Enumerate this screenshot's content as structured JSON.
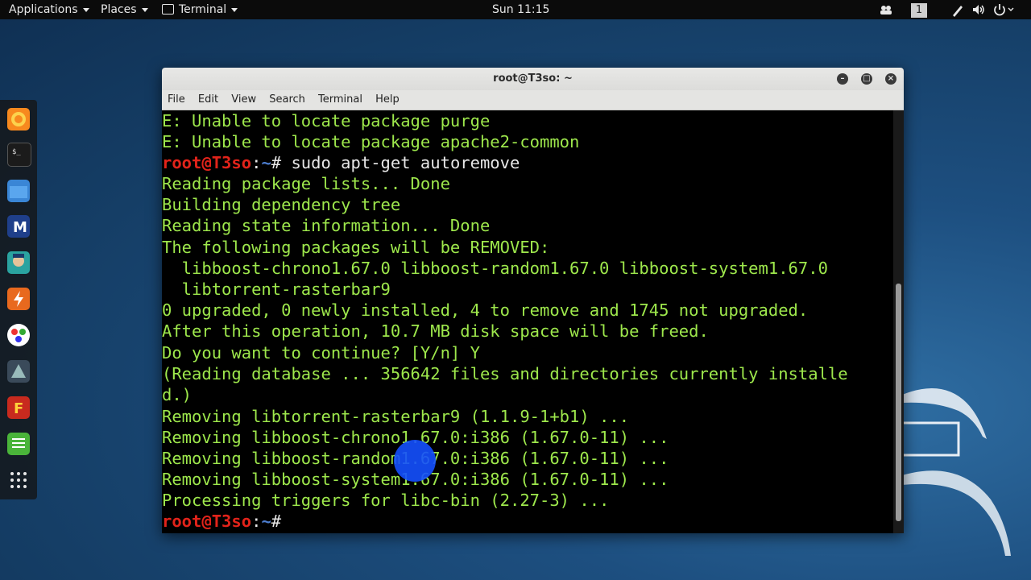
{
  "topbar": {
    "applications": "Applications",
    "places": "Places",
    "terminal": "Terminal",
    "clock": "Sun 11:15",
    "workspace": "1"
  },
  "window": {
    "title": "root@T3so: ~",
    "menu": [
      "File",
      "Edit",
      "View",
      "Search",
      "Terminal",
      "Help"
    ]
  },
  "prompt": {
    "user": "root@T3so",
    "sep": ":",
    "dir": "~",
    "hash": "#"
  },
  "command": " sudo apt-get autoremove",
  "output_before": [
    "E: Unable to locate package purge",
    "E: Unable to locate package apache2-common"
  ],
  "output_after": [
    "Reading package lists... Done",
    "Building dependency tree",
    "Reading state information... Done",
    "The following packages will be REMOVED:",
    "  libboost-chrono1.67.0 libboost-random1.67.0 libboost-system1.67.0",
    "  libtorrent-rasterbar9",
    "0 upgraded, 0 newly installed, 4 to remove and 1745 not upgraded.",
    "After this operation, 10.7 MB disk space will be freed.",
    "Do you want to continue? [Y/n] Y",
    "(Reading database ... 356642 files and directories currently installe",
    "d.)",
    "Removing libtorrent-rasterbar9 (1.1.9-1+b1) ...",
    "Removing libboost-chrono1.67.0:i386 (1.67.0-11) ...",
    "Removing libboost-random1.67.0:i386 (1.67.0-11) ...",
    "Removing libboost-system1.67.0:i386 (1.67.0-11) ...",
    "Processing triggers for libc-bin (2.27-3) ..."
  ],
  "dock_icons": [
    "firefox-icon",
    "terminal-icon",
    "files-icon",
    "metasploit-icon",
    "armitage-icon",
    "burpsuite-icon",
    "maltego-icon",
    "beef-icon",
    "faraday-icon",
    "leafpad-icon",
    "show-apps-icon"
  ],
  "colors": {
    "prompt_user": "#e2231a",
    "prompt_dir": "#4c7dcf",
    "output_text": "#9ee84c"
  }
}
